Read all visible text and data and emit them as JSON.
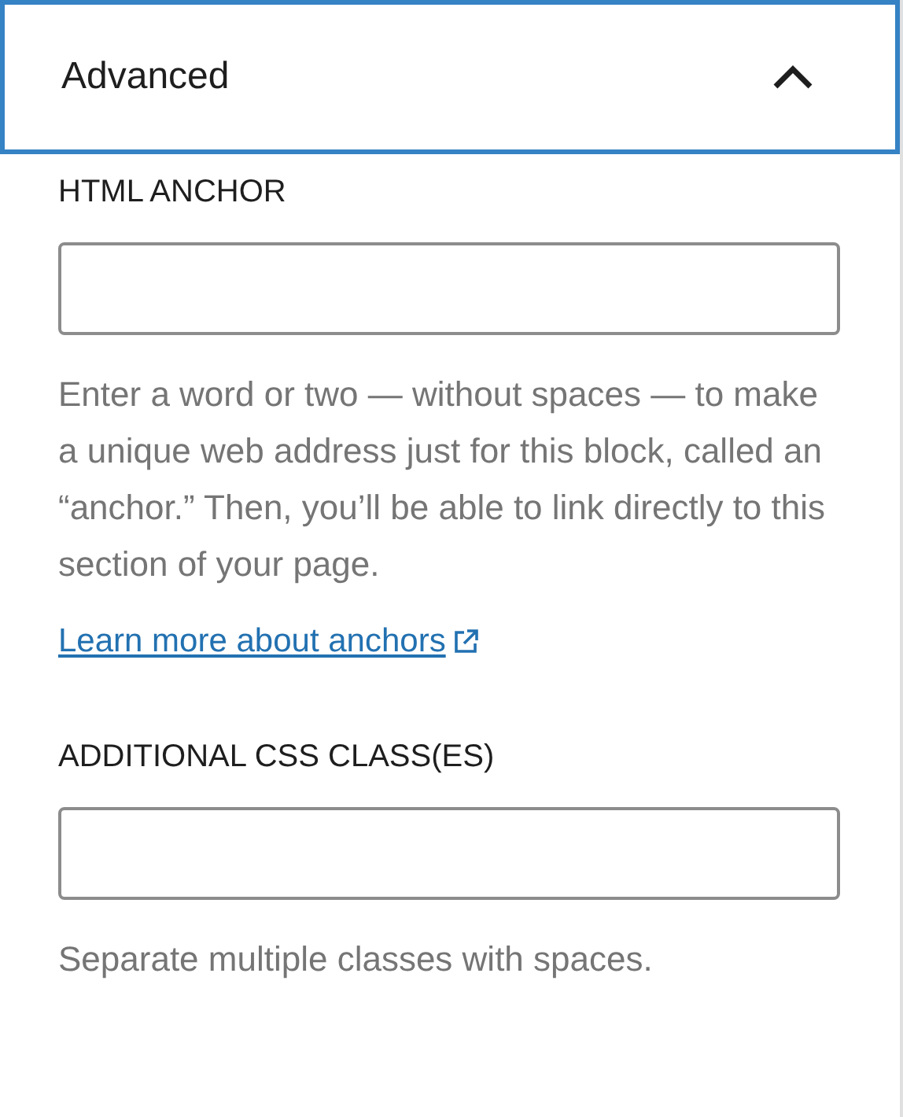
{
  "panel": {
    "title": "Advanced",
    "expanded": true
  },
  "fields": [
    {
      "label": "HTML ANCHOR",
      "help": "Enter a word or two — without spaces — to make a unique web address just for this block, called an “anchor.” Then, you’ll be able to link directly to this section of your page.",
      "link": "Learn more about anchors"
    },
    {
      "label": "ADDITIONAL CSS CLASS(ES)",
      "help": "Separate multiple classes with spaces."
    }
  ]
}
